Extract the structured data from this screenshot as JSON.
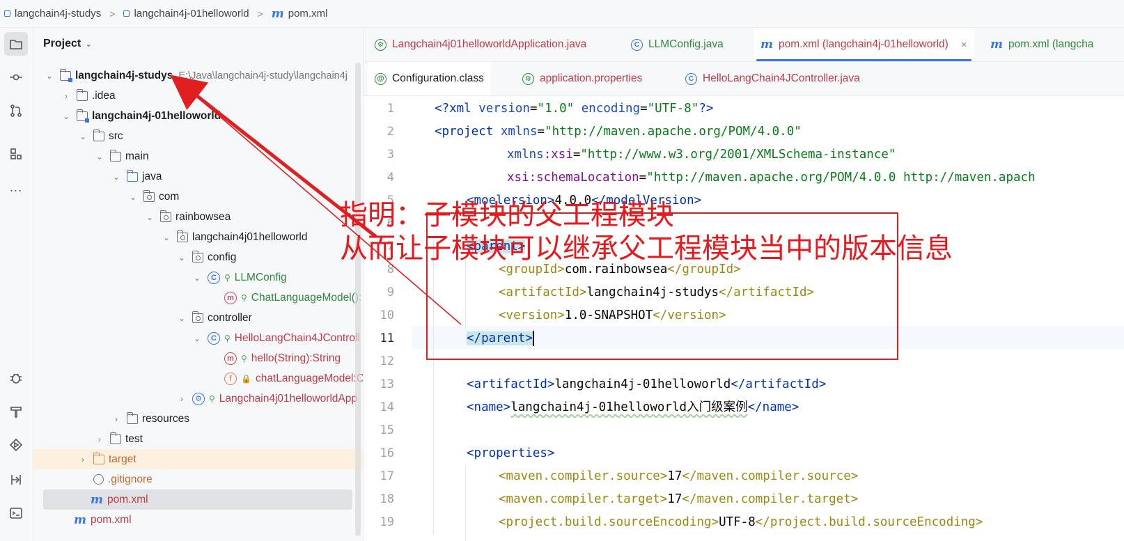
{
  "breadcrumb": {
    "items": [
      "langchain4j-studys",
      "langchain4j-01helloworld",
      "pom.xml"
    ]
  },
  "toolstrip": {
    "icons": [
      "folder-icon",
      "commit-icon",
      "pull-request-icon",
      "structure-icon",
      "more-icon",
      "debug-icon",
      "build-icon",
      "run-icon",
      "services-icon",
      "terminal-icon"
    ],
    "more_label": "..."
  },
  "project_panel": {
    "title": "Project",
    "root_label": "langchain4j-studys",
    "root_path": "E:\\Java\\langchain4j-study\\langchain4j",
    "nodes": {
      "idea": ".idea",
      "module": "langchain4j-01helloworld",
      "src": "src",
      "main": "main",
      "java": "java",
      "com": "com",
      "rainbowsea": "rainbowsea",
      "pkg": "langchain4j01helloworld",
      "config": "config",
      "llmconfig": "LLMConfig",
      "chatmodel_method": "ChatLanguageModel():",
      "controller": "controller",
      "hello_controller": "HelloLangChain4JControll",
      "hello_method": "hello(String):String",
      "chat_field": "chatLanguageModel:C",
      "app_class": "Langchain4j01helloworldApp",
      "resources": "resources",
      "test": "test",
      "target": "target",
      "gitignore": ".gitignore",
      "pom_module": "pom.xml",
      "pom_root": "pom.xml"
    },
    "icon_letters": {
      "class": "C",
      "method": "m",
      "field": "f"
    }
  },
  "tabs_row1": {
    "tab1": "Langchain4j01helloworldApplication.java",
    "tab2": "LLMConfig.java",
    "tab3": "pom.xml (langchain4j-01helloworld)",
    "tab4": "pom.xml (langcha",
    "close": "×"
  },
  "tabs_row2": {
    "tab1": "Configuration.class",
    "tab2": "application.properties",
    "tab3": "HelloLangChain4JController.java"
  },
  "editor": {
    "line_numbers": [
      "1",
      "2",
      "3",
      "4",
      "5",
      "6",
      "7",
      "8",
      "9",
      "10",
      "11",
      "12",
      "13",
      "14",
      "15",
      "16",
      "17",
      "18",
      "19"
    ],
    "current_line": 11,
    "l1": {
      "a": "<?xml ",
      "b": "version",
      "c": "=",
      "d": "\"1.0\"",
      "e": " ",
      "f": "encoding",
      "g": "=",
      "h": "\"UTF-8\"",
      "i": "?>"
    },
    "l2": {
      "a": "<project ",
      "b": "xmlns",
      "c": "=",
      "d": "\"http://maven.apache.org/POM/4.0.0\""
    },
    "l3": {
      "a": "xmlns",
      "b": ":xsi",
      "c": "=",
      "d": "\"http://www.w3.org/2001/XMLSchema-instance\""
    },
    "l4": {
      "a": "xsi",
      "b": ":schemaLocation",
      "c": "=",
      "d": "\"http://maven.apache.org/POM/4.0.0 http://maven.apach"
    },
    "l5": {
      "a": "<mo",
      "b": "el",
      "c": "ersion>",
      "d": "4.0.0",
      "e": "</",
      "f": "modelVersion>"
    },
    "l7": {
      "a": "<",
      "b": "parent",
      "c": ">"
    },
    "l8": {
      "open": "<groupId>",
      "val": "com.rainbowsea",
      "close": "</groupId>"
    },
    "l9": {
      "open": "<artifactId>",
      "val": "langchain4j-studys",
      "close": "</artifactId>"
    },
    "l10": {
      "open": "<version>",
      "val": "1.0-SNAPSHOT",
      "close": "</version>"
    },
    "l11": {
      "open": "</parent",
      "close": ">"
    },
    "l13": {
      "open": "<artifactId>",
      "val": "langchain4j-01helloworld",
      "close": "</artifactId>"
    },
    "l14": {
      "open": "<name>",
      "val": "langchain4j-01helloworld入门级案例",
      "close": "</name>"
    },
    "l16": {
      "open": "<properties>"
    },
    "l17": {
      "open": "<maven.compiler.source>",
      "val": "17",
      "close": "</maven.compiler.source>"
    },
    "l18": {
      "open": "<maven.compiler.target>",
      "val": "17",
      "close": "</maven.compiler.target>"
    },
    "l19": {
      "open": "<project.build.sourceEncoding>",
      "val": "UTF-8",
      "close": "</project.build.sourceEncoding>"
    }
  },
  "annotation": {
    "line1": "指明：子模块的父工程模块",
    "line2": "从而让子模块可以继承父工程模块当中的版本信息",
    "color": "#e8191c"
  }
}
